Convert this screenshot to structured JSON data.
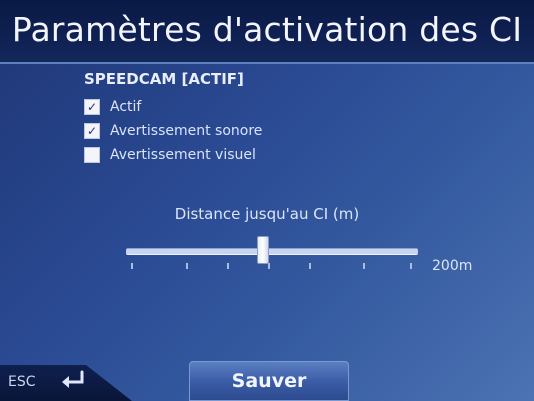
{
  "header": {
    "title": "Paramètres d'activation des CI"
  },
  "section": {
    "label": "SPEEDCAM [ACTIF]"
  },
  "options": [
    {
      "label": "Actif",
      "checked": true
    },
    {
      "label": "Avertissement sonore",
      "checked": true
    },
    {
      "label": "Avertissement visuel",
      "checked": false
    }
  ],
  "slider": {
    "label": "Distance jusqu'au CI (m)",
    "value_text": "200m",
    "position_fraction": 0.47
  },
  "footer": {
    "esc_label": "ESC",
    "enter_icon": "enter-arrow-icon",
    "save_label": "Sauver"
  }
}
